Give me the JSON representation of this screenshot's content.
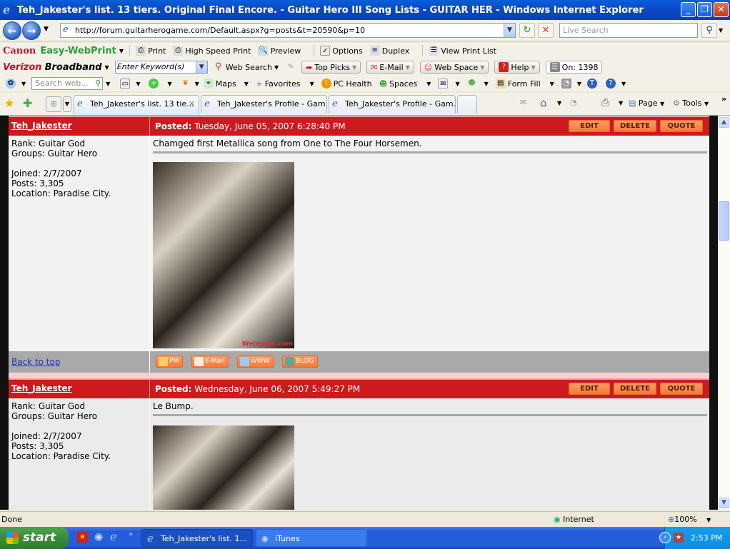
{
  "window": {
    "title": "Teh_Jakester's list. 13 tiers. Original Final Encore. - Guitar Hero III Song Lists - GUITAR HER - Windows Internet Explorer",
    "minimize": "_",
    "restore": "❐",
    "close": "✕"
  },
  "address_bar": {
    "back": "←",
    "forward": "→",
    "url": "http://forum.guitarherogame.com/Default.aspx?g=posts&t=20590&p=10",
    "refresh": "↻",
    "stop": "✕",
    "search_placeholder": "Live Search",
    "search_icon": "⚲"
  },
  "canon_toolbar": {
    "brand": "Canon",
    "product": "Easy-WebPrint",
    "items": [
      "Print",
      "High Speed Print",
      "Preview",
      "Options",
      "Duplex",
      "View Print List"
    ]
  },
  "verizon_toolbar": {
    "brand": "Verizon",
    "product": "Broadband",
    "keyword_placeholder": "Enter Keyword(s)",
    "web_search": "Web Search",
    "buttons": [
      "Top Picks",
      "E-Mail",
      "Web Space",
      "Help"
    ],
    "counter": "On: 1398"
  },
  "msn_toolbar": {
    "search_placeholder": "Search web...",
    "items": [
      "Maps",
      "Favorites",
      "PC Health",
      "Spaces",
      "Form Fill"
    ]
  },
  "tabs": [
    {
      "label": "Teh_Jakester's list. 13 tie...",
      "active": true
    },
    {
      "label": "Teh_Jakester's Profile - Gam...",
      "active": false
    },
    {
      "label": "Teh_Jakester's Profile - Gam...",
      "active": false
    }
  ],
  "command_bar": {
    "page": "Page",
    "tools": "Tools",
    "more": "»"
  },
  "posts": [
    {
      "author": "Teh_Jakester",
      "posted_label": "Posted:",
      "posted_date": "Tuesday, June 05, 2007 6:28:40 PM",
      "actions": [
        "EDIT",
        "DELETE",
        "QUOTE"
      ],
      "rank": "Rank: Guitar God",
      "groups": "Groups: Guitar Hero",
      "joined": "Joined: 2/7/2007",
      "posts": "Posts: 3,305",
      "location": "Location: Paradise City.",
      "message": "Chamged first Metallica song from One to The Four Horsemen.",
      "image_watermark": "WeImage.com",
      "back_to_top": "Back to top",
      "footer_buttons": [
        "PM",
        "E-Mail",
        "WWW",
        "BLOG"
      ]
    },
    {
      "author": "Teh_Jakester",
      "posted_label": "Posted:",
      "posted_date": "Wednesday, June 06, 2007 5:49:27 PM",
      "actions": [
        "EDIT",
        "DELETE",
        "QUOTE"
      ],
      "rank": "Rank: Guitar God",
      "groups": "Groups: Guitar Hero",
      "joined": "Joined: 2/7/2007",
      "posts": "Posts: 3,305",
      "location": "Location: Paradise City.",
      "message": "Le Bump."
    }
  ],
  "status_bar": {
    "status": "Done",
    "zone": "Internet",
    "zoom": "100%"
  },
  "taskbar": {
    "start": "start",
    "tasks": [
      "Teh_Jakester's list. 1...",
      "iTunes"
    ],
    "clock": "2:53 PM"
  }
}
